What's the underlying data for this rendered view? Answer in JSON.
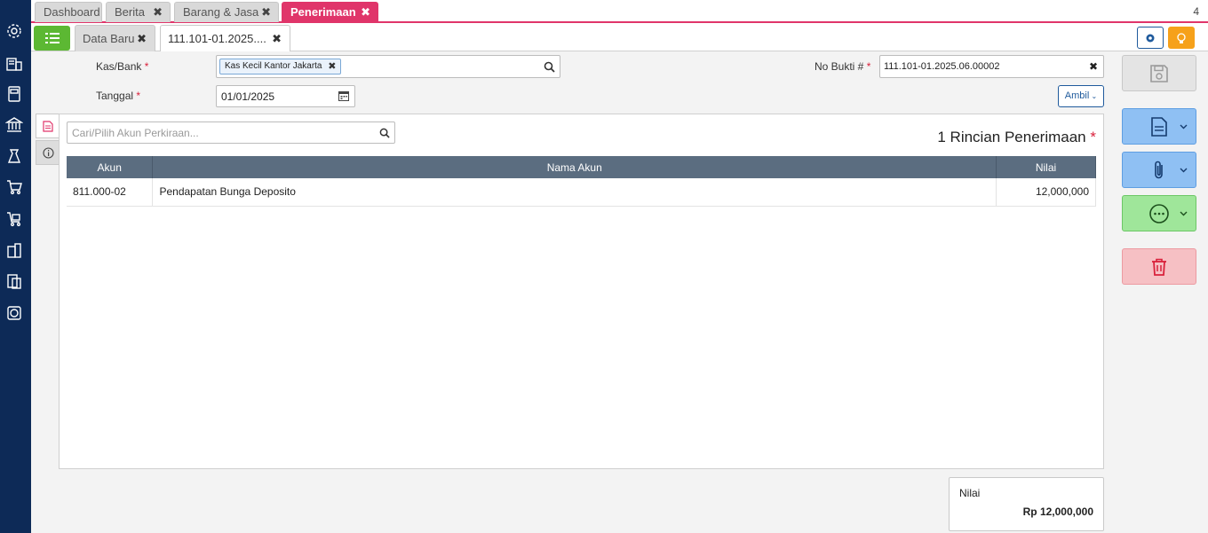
{
  "tabs_top": {
    "dashboard": "Dashboard",
    "berita": "Berita",
    "barang_jasa": "Barang & Jasa",
    "penerimaan": "Penerimaan",
    "count": "4"
  },
  "tabs_doc": {
    "data_baru": "Data Baru",
    "current": "111.101-01.2025...."
  },
  "close_glyph": "✖",
  "form": {
    "kas_bank_label": "Kas/Bank",
    "kas_bank_value": "Kas Kecil Kantor Jakarta",
    "tanggal_label": "Tanggal",
    "tanggal_value": "01/01/2025",
    "no_bukti_label": "No Bukti #",
    "no_bukti_value": "111.101-01.2025.06.00002",
    "required_mark": "*",
    "ambil_label": "Ambil"
  },
  "detail": {
    "search_placeholder": "Cari/Pilih Akun Perkiraan...",
    "title": "1 Rincian Penerimaan",
    "columns": [
      "Akun",
      "Nama Akun",
      "Nilai"
    ],
    "rows": [
      {
        "akun": "811.000-02",
        "nama_akun": "Pendapatan Bunga Deposito",
        "nilai": "12,000,000"
      }
    ]
  },
  "summary": {
    "label": "Nilai",
    "value": "Rp 12,000,000"
  },
  "colors": {
    "sidebar": "#0d2a57",
    "active_tab": "#e0356a",
    "green": "#5cb833",
    "blue_btn": "#8fc0f3",
    "green_btn": "#9fe69a",
    "red_btn": "#f6c0c4"
  }
}
